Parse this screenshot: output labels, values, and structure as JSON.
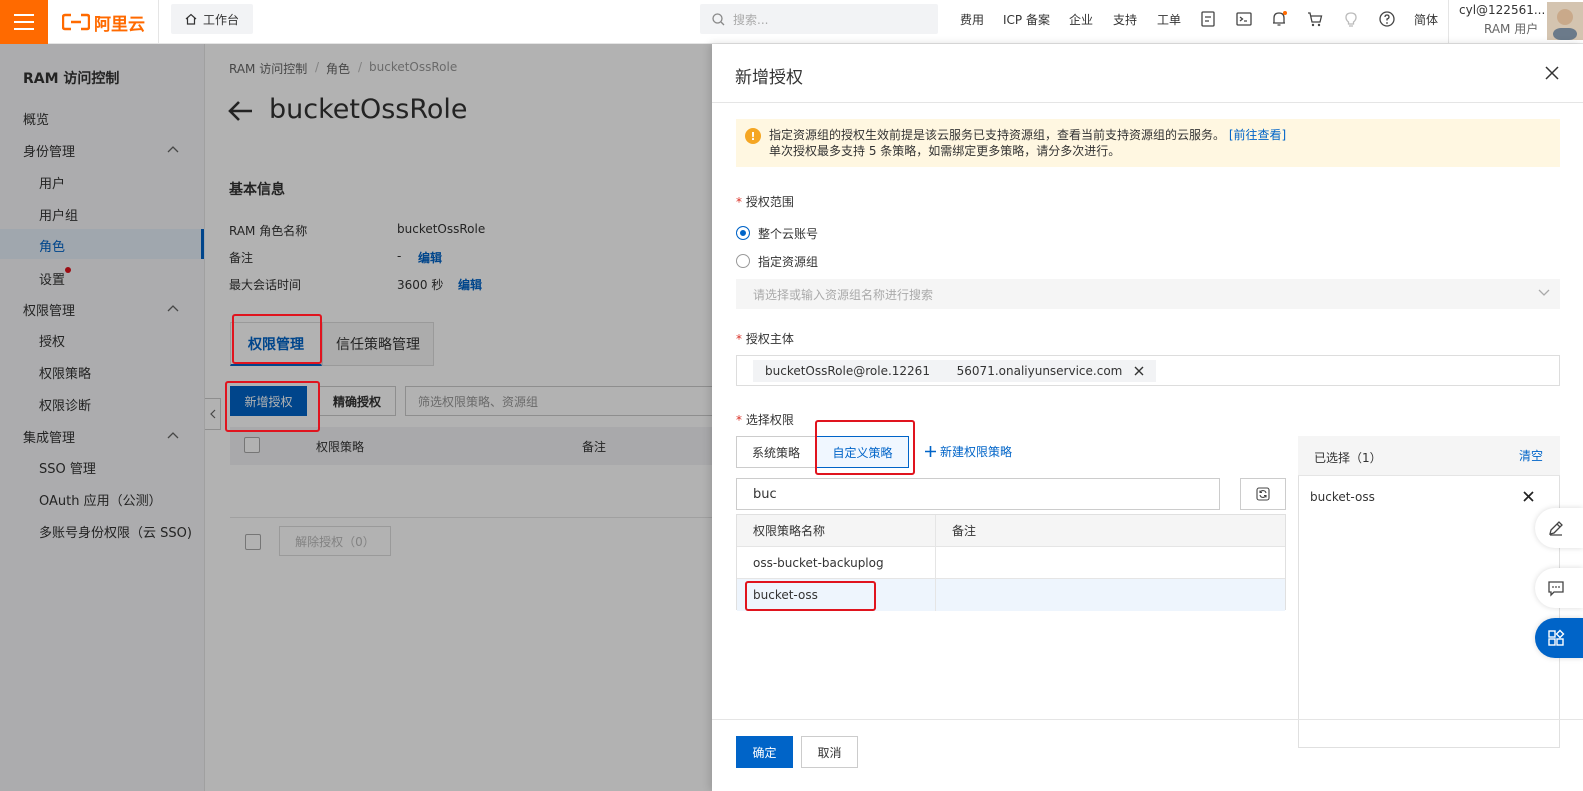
{
  "topbar": {
    "logo_text": "阿里云",
    "workbench": "工作台",
    "search_placeholder": "搜索...",
    "nav": [
      "费用",
      "ICP 备案",
      "企业",
      "支持",
      "工单"
    ],
    "lang": "简体",
    "user_name": "cyl@122561...",
    "user_role": "RAM 用户"
  },
  "sidebar": {
    "title": "RAM 访问控制",
    "overview": "概览",
    "identity": "身份管理",
    "users": "用户",
    "user_groups": "用户组",
    "roles": "角色",
    "settings": "设置",
    "permission": "权限管理",
    "grant": "授权",
    "policies": "权限策略",
    "diagnosis": "权限诊断",
    "integration": "集成管理",
    "sso": "SSO 管理",
    "oauth": "OAuth 应用（公测）",
    "multi_sso": "多账号身份权限（云 SSO)"
  },
  "main": {
    "breadcrumb": [
      "RAM 访问控制",
      "角色",
      "bucketOssRole"
    ],
    "title": "bucketOssRole",
    "basic_info": "基本信息",
    "fields": {
      "role_name_label": "RAM 角色名称",
      "role_name_value": "bucketOssRole",
      "note_label": "备注",
      "note_value": "-",
      "edit": "编辑",
      "session_label": "最大会话时间",
      "session_value": "3600 秒"
    },
    "tabs": [
      "权限管理",
      "信任策略管理"
    ],
    "add_grant": "新增授权",
    "precise_grant": "精确授权",
    "filter_placeholder": "筛选权限策略、资源组",
    "col_policy": "权限策略",
    "col_note": "备注",
    "revoke": "解除授权（0）"
  },
  "drawer": {
    "title": "新增授权",
    "notice_line1": "指定资源组的授权生效前提是该云服务已支持资源组，查看当前支持资源组的云服务。",
    "notice_link": "[前往查看]",
    "notice_line2": "单次授权最多支持 5 条策略，如需绑定更多策略，请分多次进行。",
    "scope_label": "授权范围",
    "scope_all": "整个云账号",
    "scope_rg": "指定资源组",
    "rg_placeholder": "请选择或输入资源组名称进行搜索",
    "principal_label": "授权主体",
    "principal_value": "bucketOssRole@role.12261       56071.onaliyunservice.com",
    "perm_label": "选择权限",
    "tab_system": "系统策略",
    "tab_custom": "自定义策略",
    "new_policy": "新建权限策略",
    "search_value": "buc",
    "table_headers": [
      "权限策略名称",
      "备注"
    ],
    "rows": [
      {
        "name": "oss-bucket-backuplog",
        "note": ""
      },
      {
        "name": "bucket-oss",
        "note": ""
      }
    ],
    "selected_title": "已选择（1）",
    "clear": "清空",
    "selected_items": [
      "bucket-oss"
    ],
    "ok": "确定",
    "cancel": "取消"
  },
  "colors": {
    "brand": "#ff6a00",
    "primary": "#0064c8",
    "highlight": "#e0141e"
  }
}
